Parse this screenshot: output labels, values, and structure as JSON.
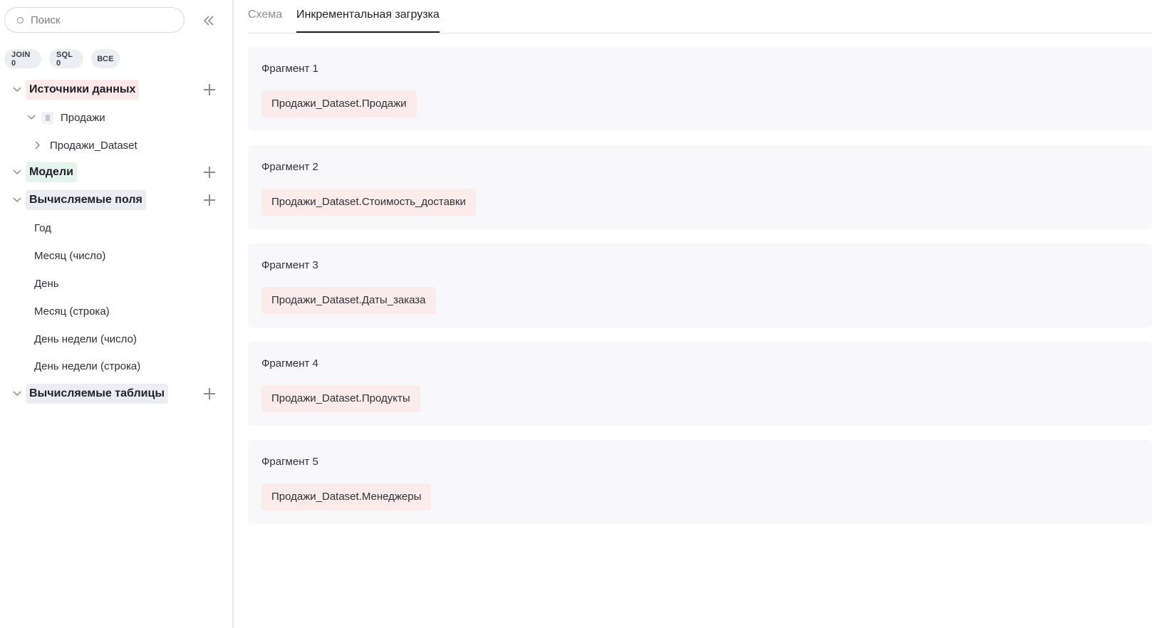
{
  "search": {
    "placeholder": "Поиск"
  },
  "filters": [
    {
      "label": "JOIN 0"
    },
    {
      "label": "SQL 0"
    },
    {
      "label": "ВСЕ"
    }
  ],
  "tree": {
    "sources": {
      "label": "Источники данных",
      "children": [
        {
          "label": "Продажи"
        },
        {
          "label": "Продажи_Dataset"
        }
      ]
    },
    "models": {
      "label": "Модели"
    },
    "calculated_fields": {
      "label": "Вычисляемые поля",
      "items": [
        {
          "label": "Год"
        },
        {
          "label": "Месяц (число)"
        },
        {
          "label": "День"
        },
        {
          "label": "Месяц (строка)"
        },
        {
          "label": "День недели (число)"
        },
        {
          "label": "День недели (строка)"
        }
      ]
    },
    "calculated_tables": {
      "label": "Вычисляемые таблицы"
    }
  },
  "tabs": [
    {
      "label": "Схема",
      "active": false
    },
    {
      "label": "Инкрементальная загрузка",
      "active": true
    }
  ],
  "fragments": [
    {
      "title": "Фрагмент 1",
      "tag": "Продажи_Dataset.Продажи"
    },
    {
      "title": "Фрагмент 2",
      "tag": "Продажи_Dataset.Стоимость_доставки"
    },
    {
      "title": "Фрагмент 3",
      "tag": "Продажи_Dataset.Даты_заказа"
    },
    {
      "title": "Фрагмент 4",
      "tag": "Продажи_Dataset.Продукты"
    },
    {
      "title": "Фрагмент 5",
      "tag": "Продажи_Dataset.Менеджеры"
    }
  ],
  "colors": {
    "sources_bg": "#fbe9e9",
    "models_bg": "#e4f4ec",
    "calc_bg": "#ecedf3",
    "tag_bg": "#fbebeb",
    "fragment_bg": "#f8f8fb"
  },
  "icons": [
    "search-icon",
    "collapse-double-chevron-left-icon",
    "chevron-down-icon",
    "chevron-right-icon",
    "plus-icon",
    "document-icon"
  ]
}
